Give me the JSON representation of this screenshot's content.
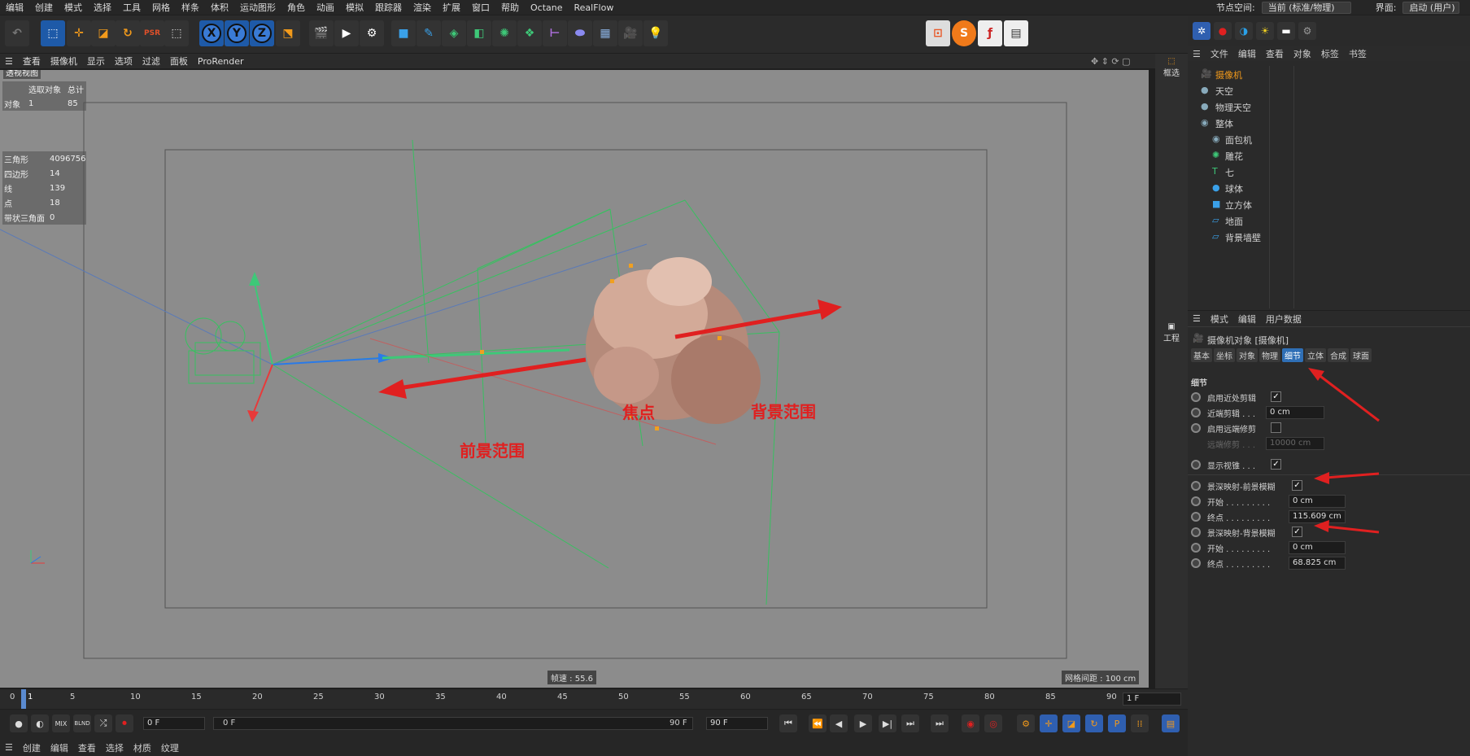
{
  "menubar": {
    "items": [
      "编辑",
      "创建",
      "模式",
      "选择",
      "工具",
      "网格",
      "样条",
      "体积",
      "运动图形",
      "角色",
      "动画",
      "模拟",
      "跟踪器",
      "渲染",
      "扩展",
      "窗口",
      "帮助",
      "Octane",
      "RealFlow"
    ],
    "node_space_label": "节点空间:",
    "node_space_value": "当前 (标准/物理)",
    "layout_label": "界面:",
    "layout_value": "启动 (用户)"
  },
  "toolbar": {
    "axis_x": "X",
    "axis_y": "Y",
    "axis_z": "Z"
  },
  "viewport_menu": {
    "items": [
      "查看",
      "摄像机",
      "显示",
      "选项",
      "过滤",
      "面板",
      "ProRender"
    ]
  },
  "viewport": {
    "title": "透视视图",
    "stats_header_selected": "选取对象",
    "stats_header_total": "总计",
    "stats_objects_label": "对象",
    "stats_objects_selected": "1",
    "stats_objects_total": "85",
    "stats_rows": [
      {
        "k": "三角形",
        "v": "4096756"
      },
      {
        "k": "四边形",
        "v": "14"
      },
      {
        "k": "线",
        "v": "139"
      },
      {
        "k": "点",
        "v": "18"
      },
      {
        "k": "带状三角面",
        "v": "0"
      }
    ],
    "label_focus": "焦点",
    "label_foreground": "前景范围",
    "label_background": "背景范围",
    "fps": "帧速 : 55.6",
    "grid_spacing": "网格间距 : 100 cm",
    "red": "#e02020"
  },
  "right_strip": {
    "box_select": "框选",
    "project": "工程"
  },
  "object_manager": {
    "menu": [
      "文件",
      "编辑",
      "查看",
      "对象",
      "标签",
      "书签"
    ],
    "objects": [
      {
        "name": "摄像机",
        "highlight": true
      },
      {
        "name": "天空",
        "highlight": false
      },
      {
        "name": "物理天空",
        "highlight": false
      },
      {
        "name": "整体",
        "highlight": false
      },
      {
        "name": "面包机",
        "highlight": false
      },
      {
        "name": "雕花",
        "highlight": false
      },
      {
        "name": "七",
        "highlight": false
      },
      {
        "name": "球体",
        "highlight": false
      },
      {
        "name": "立方体",
        "highlight": false
      },
      {
        "name": "地面",
        "highlight": false
      },
      {
        "name": "背景墙壁",
        "highlight": false
      }
    ]
  },
  "attributes": {
    "menu": [
      "模式",
      "编辑",
      "用户数据"
    ],
    "title": "摄像机对象 [摄像机]",
    "tabs": [
      "基本",
      "坐标",
      "对象",
      "物理",
      "细节",
      "立体",
      "合成",
      "球面"
    ],
    "active_tab": "细节",
    "section": "细节",
    "near_clip_label": "启用近处剪辑",
    "near_clip_checked": "✓",
    "near_clip_value_label": "近端剪辑 . . .",
    "near_clip_value": "0 cm",
    "far_clip_label": "启用远端修剪",
    "far_clip_value_label": "远端修剪 . . .",
    "far_clip_value": "10000 cm",
    "show_cone_label": "显示视锥 . . .",
    "show_cone_checked": "✓",
    "dof_front_label": "景深映射-前景模糊",
    "dof_front_checked": "✓",
    "front_start_label": "开始 . . . . . . . . .",
    "front_start_value": "0 cm",
    "front_end_label": "终点 . . . . . . . . .",
    "front_end_value": "115.609 cm",
    "dof_back_label": "景深映射-背景模糊",
    "dof_back_checked": "✓",
    "back_start_label": "开始 . . . . . . . . .",
    "back_start_value": "0 cm",
    "back_end_label": "终点 . . . . . . . . .",
    "back_end_value": "68.825 cm"
  },
  "timeline": {
    "ticks": [
      "0",
      "5",
      "10",
      "15",
      "20",
      "25",
      "30",
      "35",
      "40",
      "45",
      "50",
      "55",
      "60",
      "65",
      "70",
      "75",
      "80",
      "85",
      "90"
    ],
    "current_marker": "1",
    "frame_field": "1 F"
  },
  "transport": {
    "current_frame": "0 F",
    "range_start": "0 F",
    "range_end": "90 F",
    "max_frame": "90 F"
  },
  "material_bar": {
    "items": [
      "创建",
      "编辑",
      "查看",
      "选择",
      "材质",
      "纹理"
    ]
  }
}
